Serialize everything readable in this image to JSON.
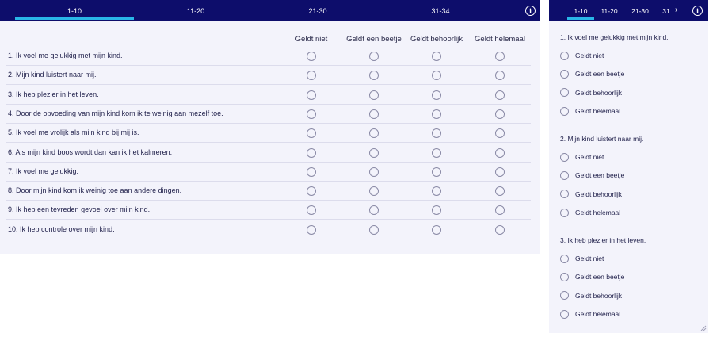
{
  "tabs": [
    {
      "label": "1-10",
      "active": true
    },
    {
      "label": "11-20",
      "active": false
    },
    {
      "label": "21-30",
      "active": false
    },
    {
      "label": "31-34",
      "active": false
    }
  ],
  "mobile_tabs": [
    {
      "label": "1-10",
      "active": true
    },
    {
      "label": "11-20",
      "active": false
    },
    {
      "label": "21-30",
      "active": false
    },
    {
      "label": "31",
      "active": false
    }
  ],
  "mobile_next_glyph": "›",
  "info_glyph": "i",
  "options": [
    "Geldt niet",
    "Geldt een beetje",
    "Geldt behoorlijk",
    "Geldt helemaal"
  ],
  "questions": [
    "1. Ik voel me gelukkig met mijn kind.",
    "2. Mijn kind luistert naar mij.",
    "3. Ik heb plezier in het leven.",
    "4. Door de opvoeding van mijn kind kom ik te weinig aan mezelf toe.",
    "5. Ik voel me vrolijk als mijn kind bij mij is.",
    "6. Als mijn kind boos wordt dan kan ik het kalmeren.",
    "7. Ik voel me gelukkig.",
    "8. Door mijn kind kom ik weinig toe aan andere dingen.",
    "9. Ik heb een tevreden gevoel over mijn kind.",
    "10. Ik heb controle over mijn kind."
  ],
  "colors": {
    "header": "#0d0d6b",
    "accent": "#29b6e8",
    "panel": "#f3f3fb"
  }
}
